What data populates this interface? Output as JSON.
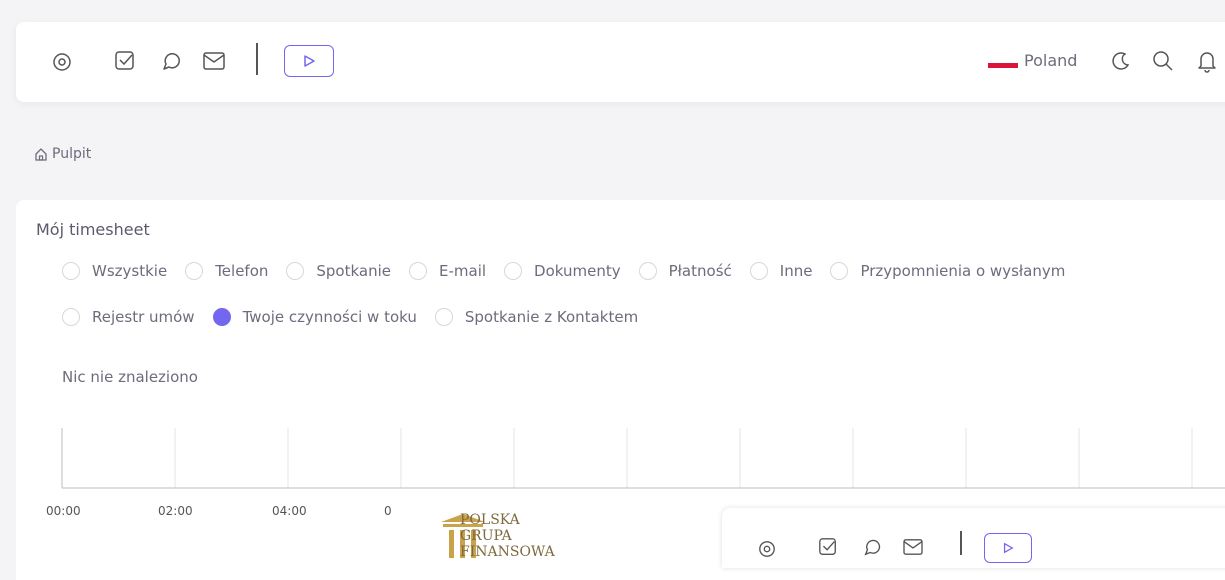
{
  "header": {
    "icons": [
      "target-icon",
      "checkbox-icon",
      "chat-icon",
      "mail-icon",
      "play-icon"
    ],
    "country": "Poland",
    "right_icons": [
      "moon-icon",
      "search-icon",
      "bell-icon"
    ]
  },
  "breadcrumb": {
    "label": "Pulpit"
  },
  "timesheet": {
    "title": "Mój timesheet",
    "filters_row1": [
      "Wszystkie",
      "Telefon",
      "Spotkanie",
      "E-mail",
      "Dokumenty",
      "Płatność",
      "Inne",
      "Przypomnienia o wysłanym"
    ],
    "filters_row2": [
      "Rejestr umów",
      "Twoje czynności w toku",
      "Spotkanie z Kontaktem"
    ],
    "selected_filter": "Twoje czynności w toku",
    "empty_message": "Nic nie znaleziono",
    "time_ticks": [
      "00:00",
      "02:00",
      "04:00",
      "0"
    ]
  },
  "logo": {
    "line1": "POLSKA",
    "line2": "GRUPA",
    "line3": "FINANSOWA"
  },
  "colors": {
    "accent": "#7367f0",
    "flag_red": "#dc143c"
  }
}
